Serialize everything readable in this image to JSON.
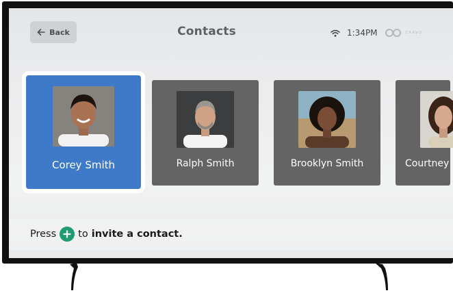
{
  "header": {
    "back_label": "Back",
    "title": "Contacts",
    "time": "1:34PM",
    "brand": "CAAVO"
  },
  "contacts": [
    {
      "name": "Corey Smith",
      "selected": true
    },
    {
      "name": "Ralph Smith",
      "selected": false
    },
    {
      "name": "Brooklyn Smith",
      "selected": false
    },
    {
      "name": "Courtney",
      "selected": false
    }
  ],
  "footer": {
    "hint_prefix": "Press",
    "hint_middle": "to",
    "hint_action": "invite a contact."
  },
  "colors": {
    "selected_card": "#3e7ac8",
    "card": "#646465",
    "accent_green": "#1f9b73",
    "bezel": "#111111"
  },
  "icons": [
    "arrow-left-icon",
    "wifi-icon",
    "caavo-logo",
    "plus-icon"
  ]
}
